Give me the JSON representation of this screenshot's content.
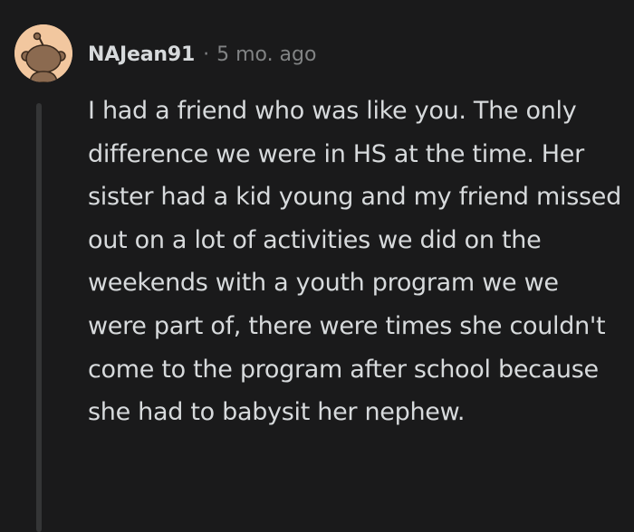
{
  "comment": {
    "author": "NAJean91",
    "separator": "·",
    "age": "5 mo. ago",
    "avatar_icon": "snoo-avatar-icon",
    "text": "I had a friend who was like you. The only difference we were in HS at the time. Her sister had a kid young and my friend missed out on a lot of activities we did on the weekends with a youth program we we were part of, there were times she couldn't come to the program after school because she had to babysit her nephew."
  },
  "colors": {
    "background": "#1a1a1b",
    "text": "#d7dadc",
    "meta": "#818384",
    "thread_line": "#343536",
    "avatar_bg": "#f2c79f"
  }
}
